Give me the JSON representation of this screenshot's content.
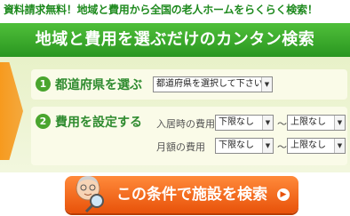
{
  "header": {
    "tagline": "資料請求無料！地域と費用から全国の老人ホームをらくらく検索！",
    "banner_title": "地域と費用を選ぶだけのカンタン検索"
  },
  "step1": {
    "number": "1",
    "label": "都道府県を選ぶ",
    "prefecture_select_value": "都道府県を選択して下さい"
  },
  "step2": {
    "number": "2",
    "label": "費用を設定する",
    "entry_cost_label": "入居時の費用",
    "monthly_cost_label": "月額の費用",
    "entry_min_value": "下限なし",
    "entry_max_value": "上限なし",
    "monthly_min_value": "下限なし",
    "monthly_max_value": "上限なし",
    "range_separator": "～"
  },
  "search_button": {
    "label": "この条件で施設を検索"
  },
  "icons": {
    "dropdown": "chevron-down-icon",
    "button_arrow": "arrow-right-icon",
    "mascot": "elderly-magnifier-mascot"
  },
  "colors": {
    "brand_green": "#2a9620",
    "accent_orange": "#e8520a",
    "panel_bg": "#e8f1c8"
  }
}
